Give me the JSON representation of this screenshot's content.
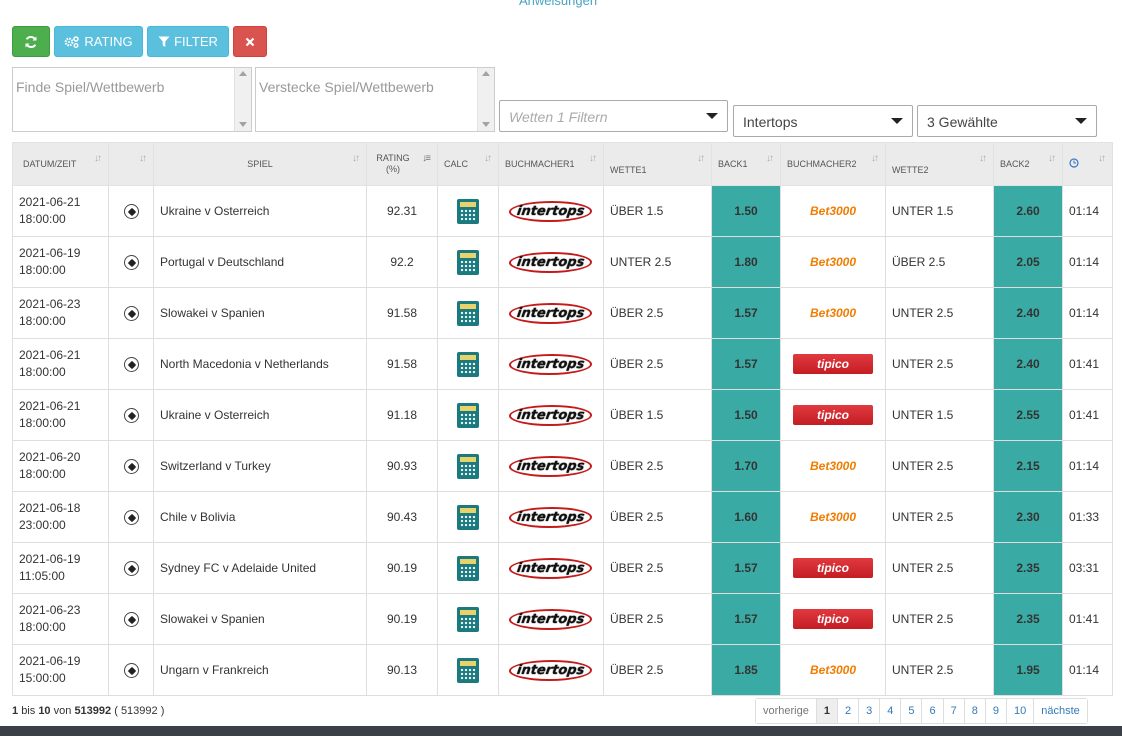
{
  "header": {
    "top_link": "Anweisungen"
  },
  "toolbar": {
    "refresh_icon": "refresh-icon",
    "rating_label": "RATING",
    "filter_label": "FILTER",
    "clear_icon": "close-icon",
    "colors": {
      "refresh": "#4cae4c",
      "info": "#5bc0de",
      "danger": "#d9534f"
    }
  },
  "filters": {
    "search_placeholder": "Finde Spiel/Wettbewerb",
    "hide_placeholder": "Verstecke Spiel/Wettbewerb",
    "bet_filter_placeholder": "Wetten 1 Filtern",
    "bookmaker_selected": "Intertops",
    "multi_selected": "3 Gewählte"
  },
  "table": {
    "headers": [
      "DATUM/ZEIT",
      "",
      "SPIEL",
      "RATING (%)",
      "CALC",
      "BUCHMACHER1",
      "WETTE1",
      "BACK1",
      "BUCHMACHER2",
      "WETTE2",
      "BACK2",
      "clock-icon"
    ],
    "rows": [
      {
        "date": "2021-06-21",
        "time": "18:00:00",
        "game": "Ukraine v Osterreich",
        "rating": "92.31",
        "bm1": "intertops",
        "bet1": "ÜBER 1.5",
        "back1": "1.50",
        "bm2": "Bet3000",
        "bet2": "UNTER 1.5",
        "back2": "2.60",
        "age": "01:14"
      },
      {
        "date": "2021-06-19",
        "time": "18:00:00",
        "game": "Portugal v Deutschland",
        "rating": "92.2",
        "bm1": "intertops",
        "bet1": "UNTER 2.5",
        "back1": "1.80",
        "bm2": "Bet3000",
        "bet2": "ÜBER 2.5",
        "back2": "2.05",
        "age": "01:14"
      },
      {
        "date": "2021-06-23",
        "time": "18:00:00",
        "game": "Slowakei v Spanien",
        "rating": "91.58",
        "bm1": "intertops",
        "bet1": "ÜBER 2.5",
        "back1": "1.57",
        "bm2": "Bet3000",
        "bet2": "UNTER 2.5",
        "back2": "2.40",
        "age": "01:14"
      },
      {
        "date": "2021-06-21",
        "time": "18:00:00",
        "game": "North Macedonia v Netherlands",
        "rating": "91.58",
        "bm1": "intertops",
        "bet1": "ÜBER 2.5",
        "back1": "1.57",
        "bm2": "tipico",
        "bet2": "UNTER 2.5",
        "back2": "2.40",
        "age": "01:41"
      },
      {
        "date": "2021-06-21",
        "time": "18:00:00",
        "game": "Ukraine v Osterreich",
        "rating": "91.18",
        "bm1": "intertops",
        "bet1": "ÜBER 1.5",
        "back1": "1.50",
        "bm2": "tipico",
        "bet2": "UNTER 1.5",
        "back2": "2.55",
        "age": "01:41"
      },
      {
        "date": "2021-06-20",
        "time": "18:00:00",
        "game": "Switzerland v Turkey",
        "rating": "90.93",
        "bm1": "intertops",
        "bet1": "ÜBER 2.5",
        "back1": "1.70",
        "bm2": "Bet3000",
        "bet2": "UNTER 2.5",
        "back2": "2.15",
        "age": "01:14"
      },
      {
        "date": "2021-06-18",
        "time": "23:00:00",
        "game": "Chile v Bolivia",
        "rating": "90.43",
        "bm1": "intertops",
        "bet1": "ÜBER 2.5",
        "back1": "1.60",
        "bm2": "Bet3000",
        "bet2": "UNTER 2.5",
        "back2": "2.30",
        "age": "01:33"
      },
      {
        "date": "2021-06-19",
        "time": "11:05:00",
        "game": "Sydney FC v Adelaide United",
        "rating": "90.19",
        "bm1": "intertops",
        "bet1": "ÜBER 2.5",
        "back1": "1.57",
        "bm2": "tipico",
        "bet2": "UNTER 2.5",
        "back2": "2.35",
        "age": "03:31"
      },
      {
        "date": "2021-06-23",
        "time": "18:00:00",
        "game": "Slowakei v Spanien",
        "rating": "90.19",
        "bm1": "intertops",
        "bet1": "ÜBER 2.5",
        "back1": "1.57",
        "bm2": "tipico",
        "bet2": "UNTER 2.5",
        "back2": "2.35",
        "age": "01:41"
      },
      {
        "date": "2021-06-19",
        "time": "15:00:00",
        "game": "Ungarn v Frankreich",
        "rating": "90.13",
        "bm1": "intertops",
        "bet1": "ÜBER 2.5",
        "back1": "1.85",
        "bm2": "Bet3000",
        "bet2": "UNTER 2.5",
        "back2": "1.95",
        "age": "01:14"
      }
    ],
    "back_color": "#3aaba4"
  },
  "footer": {
    "from": "1",
    "bis": "bis",
    "to": "10",
    "von": "von",
    "total": "513992",
    "total_paren": "( 513992 )"
  },
  "pagination": {
    "prev": "vorherige",
    "pages": [
      "1",
      "2",
      "3",
      "4",
      "5",
      "6",
      "7",
      "8",
      "9",
      "10"
    ],
    "active": "1",
    "next": "nächste"
  }
}
